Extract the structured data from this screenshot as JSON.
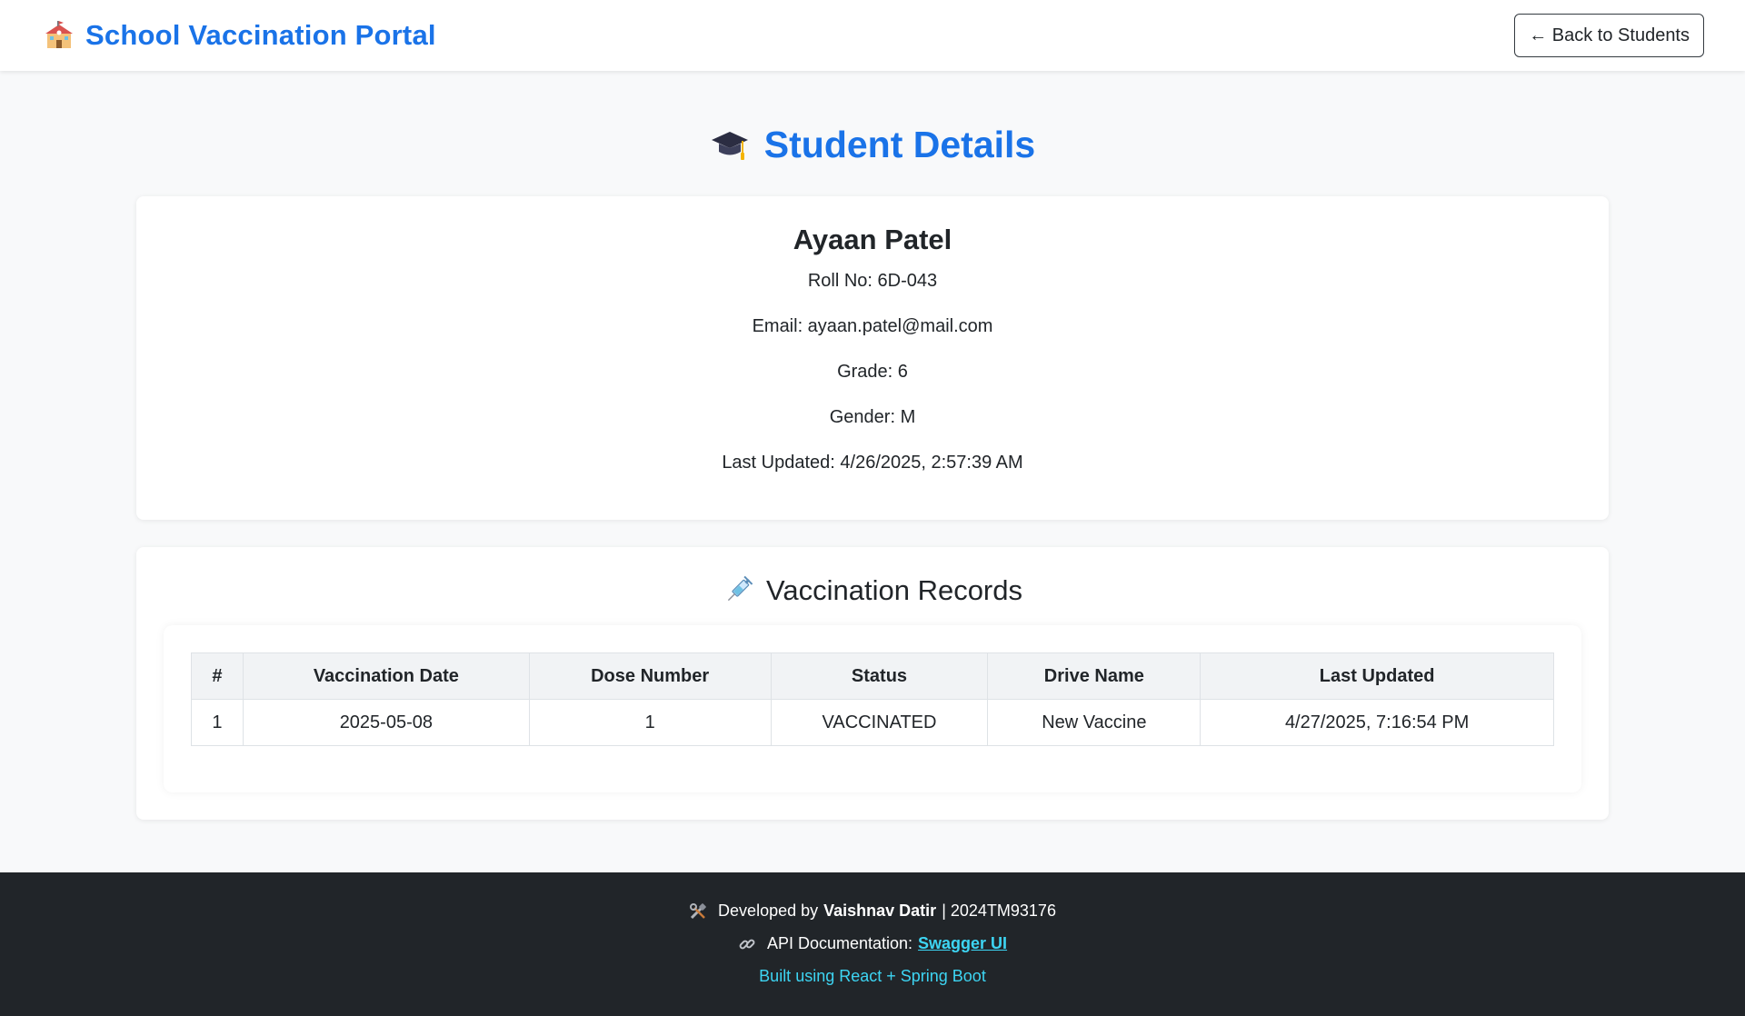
{
  "navbar": {
    "brand_icon": "school-icon",
    "title": "School Vaccination Portal",
    "back_button": "← Back to Students"
  },
  "page": {
    "heading_icon": "graduation-cap-icon",
    "title": "Student Details"
  },
  "student": {
    "name": "Ayaan Patel",
    "roll": "Roll No: 6D-043",
    "email": "Email: ayaan.patel@mail.com",
    "grade": "Grade: 6",
    "gender": "Gender: M",
    "last_updated": "Last Updated: 4/26/2025, 2:57:39 AM"
  },
  "records": {
    "icon": "syringe-icon",
    "title": "Vaccination Records",
    "columns": [
      "#",
      "Vaccination Date",
      "Dose Number",
      "Status",
      "Drive Name",
      "Last Updated"
    ],
    "rows": [
      [
        "1",
        "2025-05-08",
        "1",
        "VACCINATED",
        "New Vaccine",
        "4/27/2025, 7:16:54 PM"
      ]
    ]
  },
  "footer": {
    "dev_icon": "tools-icon",
    "dev_prefix": "Developed by",
    "dev_name": "Vaishnav Datir",
    "dev_suffix": "| 2024TM93176",
    "api_icon": "link-icon",
    "api_prefix": "API Documentation:",
    "api_link": "Swagger UI",
    "built": "Built using React + Spring Boot"
  },
  "colors": {
    "accent": "#1a73e8",
    "footer_bg": "#212529",
    "footer_link": "#3dd5f3"
  }
}
